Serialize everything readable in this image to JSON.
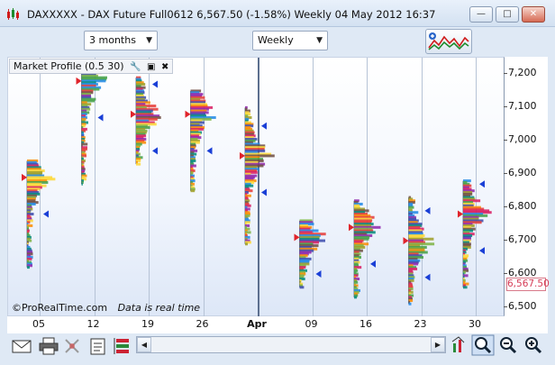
{
  "window": {
    "title": "DAXXXXX - DAX Future Full0612    6,567.50 (-1.58%)    Weekly  04 May 2012 16:37",
    "minimize_label": "—",
    "maximize_label": "□",
    "close_label": "✕"
  },
  "toolbar": {
    "period": "3 months",
    "interval": "Weekly",
    "indicator_icon": "add-indicator-icon"
  },
  "chart": {
    "indicator_label": "Market Profile (0.5 30)",
    "watermark": "©ProRealTime.com",
    "realtime_text": "Data is real time",
    "current_price": "6,567.50",
    "price_ticks": [
      "7,200",
      "7,100",
      "7,000",
      "6,900",
      "6,800",
      "6,700",
      "6,600",
      "6,500"
    ],
    "date_ticks": [
      "05",
      "12",
      "19",
      "26",
      "Apr",
      "09",
      "16",
      "23",
      "30"
    ]
  },
  "chart_data": {
    "type": "market-profile",
    "title": "Market Profile (0.5 30)",
    "instrument": "DAX Future Full0612",
    "ylim": [
      6470,
      7250
    ],
    "x": [
      "05",
      "12",
      "19",
      "26",
      "Apr",
      "09",
      "16",
      "23",
      "30"
    ],
    "weeks": [
      {
        "x": "05",
        "high": 6940,
        "low": 6620,
        "poc": 6890
      },
      {
        "x": "12",
        "high": 7220,
        "low": 6870,
        "poc": 7180
      },
      {
        "x": "19",
        "high": 7190,
        "low": 6930,
        "poc": 7080
      },
      {
        "x": "26",
        "high": 7150,
        "low": 6850,
        "poc": 7080
      },
      {
        "x": "Apr",
        "high": 7100,
        "low": 6690,
        "poc": 6955
      },
      {
        "x": "09",
        "high": 6760,
        "low": 6560,
        "poc": 6710
      },
      {
        "x": "16",
        "high": 6820,
        "low": 6530,
        "poc": 6740
      },
      {
        "x": "23",
        "high": 6830,
        "low": 6510,
        "poc": 6700
      },
      {
        "x": "30",
        "high": 6880,
        "low": 6560,
        "poc": 6780
      }
    ]
  },
  "bottom": {
    "icons": [
      "email-icon",
      "print-icon",
      "delete-icon",
      "properties-icon",
      "layers-icon"
    ],
    "zoom_icons": [
      "chart-settings-icon",
      "zoom-fit-icon",
      "zoom-out-icon",
      "zoom-in-icon"
    ]
  },
  "colors": {
    "accent": "#3b5b8a",
    "poc_marker": "#e0242b",
    "value_marker": "#1a3fd6",
    "current_price": "#d53a55"
  }
}
